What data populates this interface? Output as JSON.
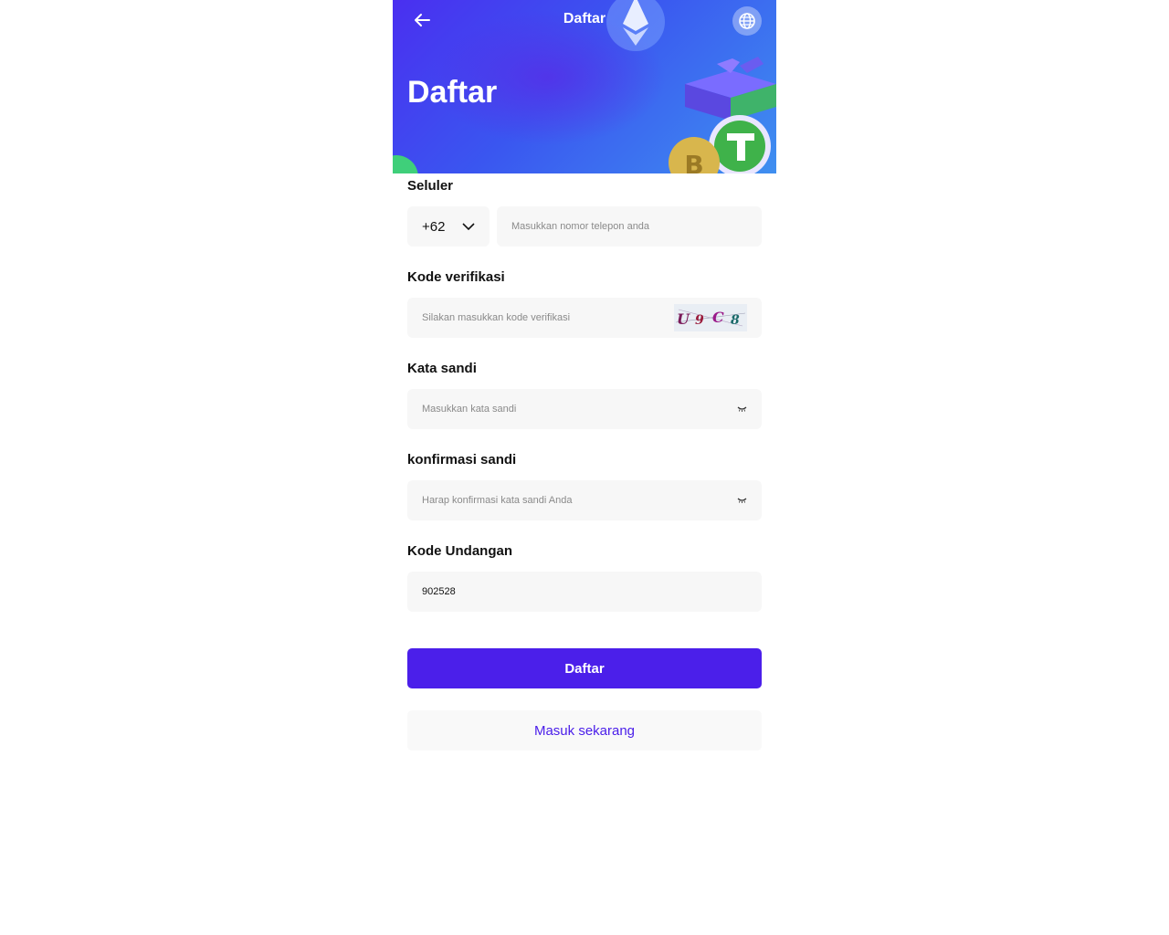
{
  "header": {
    "top_title": "Daftar",
    "hero_title": "Daftar",
    "icons": {
      "back": "arrow-left-icon",
      "language": "globe-icon"
    }
  },
  "form": {
    "phone": {
      "label": "Seluler",
      "country_code": "+62",
      "placeholder": "Masukkan nomor telepon anda"
    },
    "verification": {
      "label": "Kode verifikasi",
      "placeholder": "Silakan masukkan kode verifikasi",
      "captcha_text": "U9C8"
    },
    "password": {
      "label": "Kata sandi",
      "placeholder": "Masukkan kata sandi"
    },
    "confirm_password": {
      "label": "konfirmasi sandi",
      "placeholder": "Harap konfirmasi kata sandi Anda"
    },
    "invite": {
      "label": "Kode Undangan",
      "value": "902528"
    }
  },
  "actions": {
    "register_label": "Daftar",
    "login_label": "Masuk sekarang"
  },
  "colors": {
    "primary": "#4b1fea",
    "field_bg": "#f7f7f7",
    "banner_start": "#4a2ff0",
    "banner_end": "#3f8ff0"
  }
}
